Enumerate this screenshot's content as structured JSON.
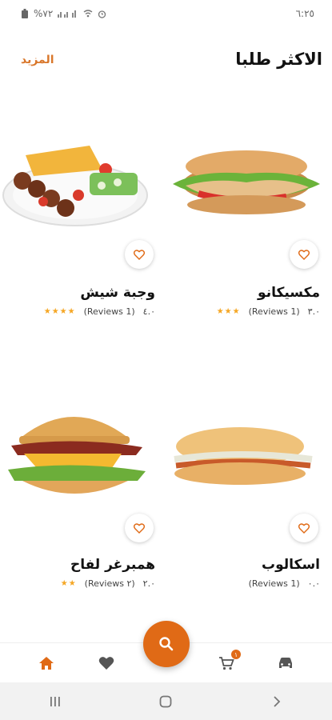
{
  "status_bar": {
    "left_text": "%٧٢",
    "time": "٦:٢٥",
    "icons": [
      "battery-icon",
      "signal-icon",
      "wifi-icon",
      "alarm-icon"
    ]
  },
  "header": {
    "title": "الاكثر طلبا",
    "more_label": "المزيد"
  },
  "products": [
    {
      "name": "مكسيكانو",
      "rating_value": "٣.٠",
      "reviews": "(1 Reviews)",
      "stars": "★★★",
      "image": "sandwich-image"
    },
    {
      "name": "وجبة شيش",
      "rating_value": "٤.٠",
      "reviews": "(1 Reviews)",
      "stars": "★★★★",
      "image": "shish-platter-image"
    },
    {
      "name": "اسكالوب",
      "rating_value": "٠.٠",
      "reviews": "(1 Reviews)",
      "stars": "",
      "image": "escalope-sandwich-image"
    },
    {
      "name": "همبرغر لفاح",
      "rating_value": "٢.٠",
      "reviews": "(٢ Reviews)",
      "stars": "★★",
      "image": "burger-image"
    }
  ],
  "bottom_nav": {
    "items": [
      "home-icon",
      "heart-icon",
      "search-icon",
      "cart-icon",
      "car-icon"
    ],
    "cart_count": "١"
  },
  "colors": {
    "accent": "#e06a16",
    "more_link": "#d9772b",
    "star": "#f5a623"
  }
}
